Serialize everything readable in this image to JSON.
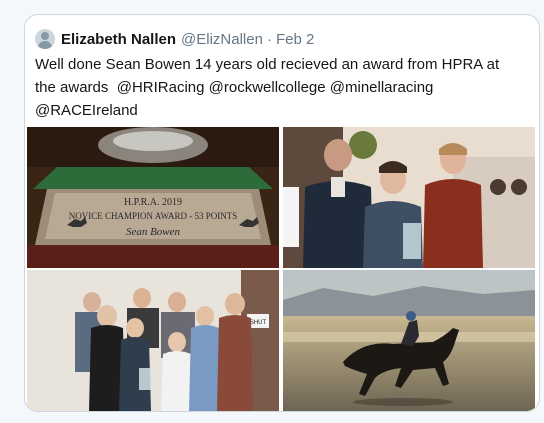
{
  "tweet": {
    "author_name": "Elizabeth Nallen",
    "author_handle": "@ElizNallen",
    "separator": "·",
    "date": "Feb 2",
    "text_line1": "Well done Sean Bowen 14 years old recieved an award from HPRA at",
    "text_line2_start": "the awards",
    "mentions": [
      "@HRIRacing",
      "@rockwellcollege",
      "@minellaracing",
      "@RACEIreland"
    ]
  },
  "photos": {
    "plaque": {
      "line1": "H.P.R.A. 2019",
      "line2": "NOVICE CHAMPION AWARD - 53 POINTS",
      "line3": "Sean Bowen"
    },
    "sign_text": "SHUT"
  },
  "colors": {
    "text": "#14171a",
    "secondary": "#657786",
    "border": "#ccd6dd",
    "background": "#f5f8fa"
  }
}
